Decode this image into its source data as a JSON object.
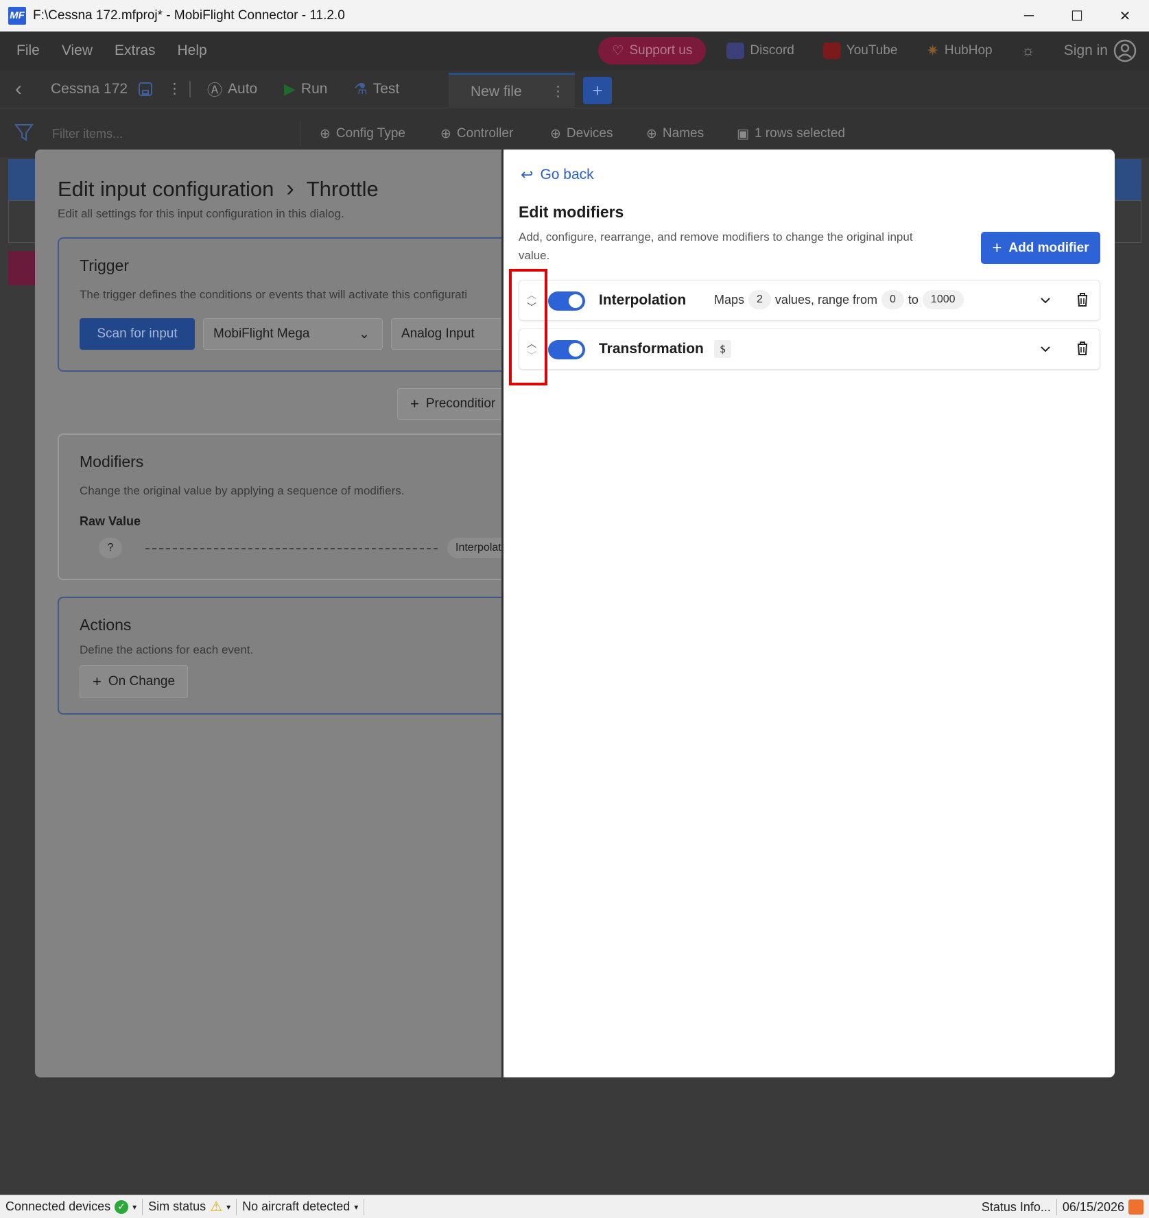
{
  "window": {
    "title": "F:\\Cessna 172.mfproj* - MobiFlight Connector - 11.2.0",
    "logo_text": "MF",
    "minimize": "─",
    "maximize": "☐",
    "close": "✕"
  },
  "menu": {
    "items": [
      "File",
      "View",
      "Extras",
      "Help"
    ],
    "support_label": "Support us",
    "discord_label": "Discord",
    "youtube_label": "YouTube",
    "hubhop_label": "HubHop",
    "signin_label": "Sign in"
  },
  "toolbar": {
    "back": "‹",
    "project_name": "Cessna 172",
    "more": "⋮",
    "auto_label": "Auto",
    "run_label": "Run",
    "test_label": "Test",
    "tab_label": "New file",
    "tab_more": "⋮",
    "add_tab": "+"
  },
  "filterbar": {
    "placeholder": "Filter items...",
    "chips": [
      "Config Type",
      "Controller",
      "Devices",
      "Names"
    ],
    "selected_label": "1 rows selected"
  },
  "edit": {
    "title": "Edit input configuration",
    "separator": "›",
    "title_item": "Throttle",
    "subtitle": "Edit all settings for this input configuration in this dialog.",
    "trigger": {
      "title": "Trigger",
      "desc": "The trigger defines the conditions or events that will activate this configurati",
      "scan_label": "Scan for input",
      "controller_value": "MobiFlight Mega",
      "device_value": "Analog Input"
    },
    "precondition_label": "Preconditior",
    "modifiers": {
      "title": "Modifiers",
      "desc": "Change the original value by applying a sequence of modifiers.",
      "raw_label": "Raw Value",
      "raw_value": "?",
      "chain_pill": "Interpolati"
    },
    "actions": {
      "title": "Actions",
      "desc": "Define the actions for each event.",
      "onchange_label": "On Change"
    }
  },
  "modifiers_panel": {
    "go_back": "Go back",
    "title": "Edit modifiers",
    "desc": "Add, configure, rearrange, and remove modifiers to change the original input value.",
    "add_label": "Add modifier",
    "rows": [
      {
        "name": "Interpolation",
        "enabled": true,
        "summary_maps": "Maps",
        "summary_count": "2",
        "summary_values": "values, range from",
        "summary_from": "0",
        "summary_to_label": "to",
        "summary_to": "1000"
      },
      {
        "name": "Transformation",
        "enabled": true,
        "expression": "$"
      }
    ]
  },
  "status": {
    "connected_label": "Connected devices",
    "sim_label": "Sim status",
    "aircraft_label": "No aircraft detected",
    "status_info": "Status Info...",
    "date": "06/15/2026"
  },
  "colors": {
    "accent": "#2d63d6",
    "highlight": "#e10000"
  }
}
